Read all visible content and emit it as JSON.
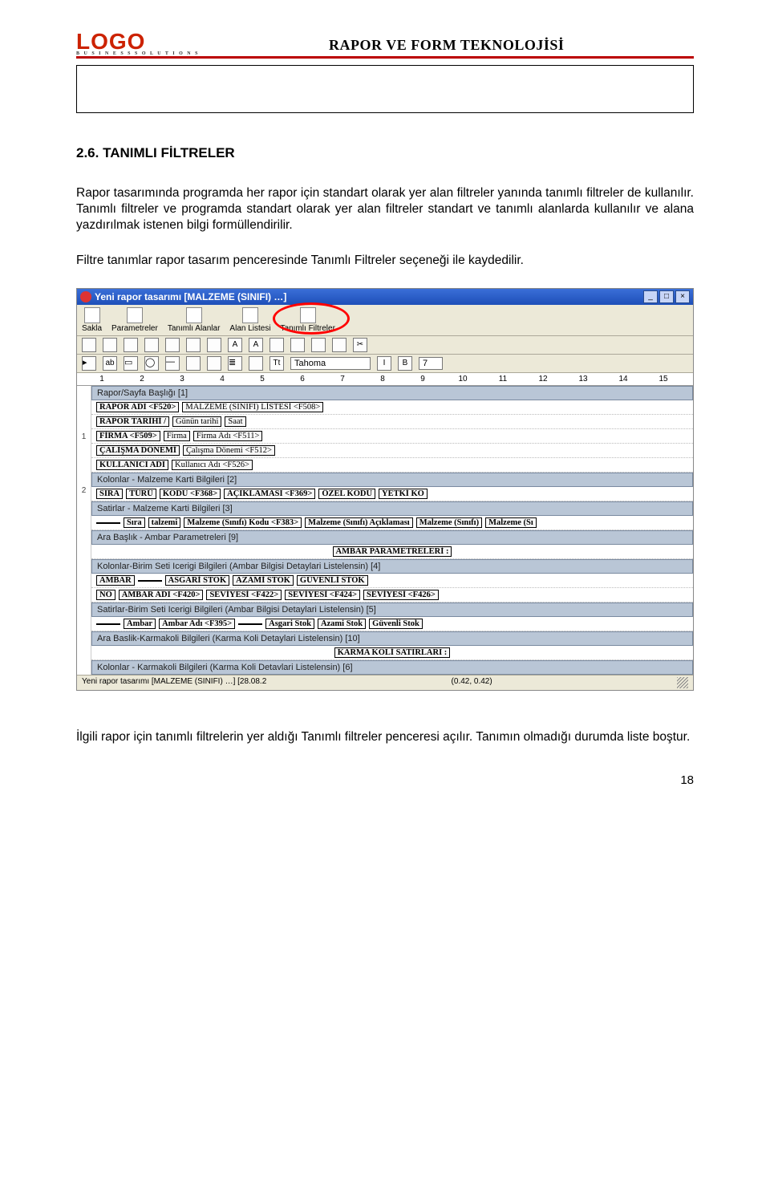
{
  "header": {
    "logo": "LOGO",
    "logo_sub": "B U S I N E S S   S O L U T I O N S",
    "title": "RAPOR VE FORM TEKNOLOJİSİ"
  },
  "section_title": "2.6. TANIMLI FİLTRELER",
  "para1": "Rapor tasarımında programda her rapor için standart olarak yer alan filtreler yanında tanımlı filtreler de kullanılır. Tanımlı filtreler ve programda standart olarak yer alan filtreler standart ve tanımlı alanlarda kullanılır ve alana yazdırılmak istenen bilgi formüllendirilir.",
  "para2": "Filtre tanımlar rapor tasarım penceresinde Tanımlı Filtreler seçeneği ile kaydedilir.",
  "app": {
    "title": "Yeni rapor tasarımı [MALZEME (SINIFI) …]",
    "winbtns": [
      "_",
      "□",
      "×"
    ],
    "toolbar": [
      {
        "icon": "save",
        "label": "Sakla"
      },
      {
        "icon": "check",
        "label": "Parametreler"
      },
      {
        "icon": "fields",
        "label": "Tanımlı Alanlar"
      },
      {
        "icon": "list",
        "label": "Alan Listesi"
      },
      {
        "icon": "filter",
        "label": "Tanımlı Filtreler",
        "circled": true
      }
    ],
    "ruler": [
      "1",
      "2",
      "3",
      "4",
      "5",
      "6",
      "7",
      "8",
      "9",
      "10",
      "11",
      "12",
      "13",
      "14",
      "15"
    ],
    "vruler": [
      "",
      "1",
      "",
      "2",
      ""
    ],
    "font": "Tahoma",
    "fontsize": "7",
    "fontstyle": [
      "I",
      "B"
    ],
    "bands": [
      {
        "label": "Rapor/Sayfa Başlığı [1]",
        "rows": [
          [
            "RAPOR ADI <F520>",
            "MALZEME (SINIFI) LİSTESİ <F508>"
          ],
          [
            "RAPOR TARİHİ /",
            "Günün tarihi",
            "Saat"
          ],
          [
            "FİRMA <F509>",
            "Firma",
            "Firma Adı <F511>"
          ],
          [
            "ÇALIŞMA DÖNEMİ",
            "Çalışma Dönemi <F512>"
          ],
          [
            "KULLANICI ADI",
            "Kullanıcı Adı <F526>"
          ]
        ]
      },
      {
        "label": "Kolonlar - Malzeme Karti Bilgileri [2]",
        "header": [
          "SIRA",
          "TÜRÜ",
          "KODU <F368>",
          "AÇIKLAMASI <F369>",
          "ÖZEL KODU",
          "YETKİ KO"
        ]
      },
      {
        "label": "Satirlar - Malzeme Karti Bilgileri [3]",
        "header": [
          "",
          "Sıra",
          "talzemi",
          "Malzeme (Sınıfı) Kodu <F383>",
          "Malzeme (Sınıfı) Açıklaması",
          "Malzeme (Sınıfı)",
          "Malzeme (Sı"
        ]
      },
      {
        "label": "Ara Başlık - Ambar Parametreleri [9]",
        "center": "AMBAR PARAMETRELERİ :"
      },
      {
        "label": "Kolonlar-Birim Seti Icerigi Bilgileri (Ambar Bilgisi Detaylari Listelensin) [4]",
        "twolines": {
          "top": [
            "AMBAR",
            "",
            "ASGARİ STOK",
            "AZAMİ STOK",
            "GÜVENLİ STOK"
          ],
          "bot": [
            "NO",
            "AMBAR ADI <F420>",
            "SEVİYESİ <F422>",
            "SEVİYESİ <F424>",
            "SEVİYESİ <F426>"
          ]
        }
      },
      {
        "label": "Satirlar-Birim Seti Icerigi Bilgileri (Ambar Bilgisi Detaylari Listelensin) [5]",
        "header": [
          "",
          "Ambar",
          "Ambar Adı <F395>",
          "",
          "Asgari Stok",
          "Azami Stok",
          "Güvenli Stok"
        ]
      },
      {
        "label": "Ara Baslik-Karmakoli Bilgileri (Karma Koli Detaylari Listelensin) [10]",
        "center": "KARMA KOLİ SATIRLARI :"
      },
      {
        "label": "Kolonlar - Karmakoli Bilgileri (Karma Koli Detavlari Listelensin) [6]"
      }
    ],
    "status_left": "Yeni rapor tasarımı [MALZEME (SINIFI) …] [28.08.2",
    "status_right": "(0.42, 0.42)"
  },
  "para3": "İlgili rapor için tanımlı filtrelerin yer aldığı Tanımlı filtreler penceresi açılır. Tanımın olmadığı durumda liste boştur.",
  "page_number": "18"
}
